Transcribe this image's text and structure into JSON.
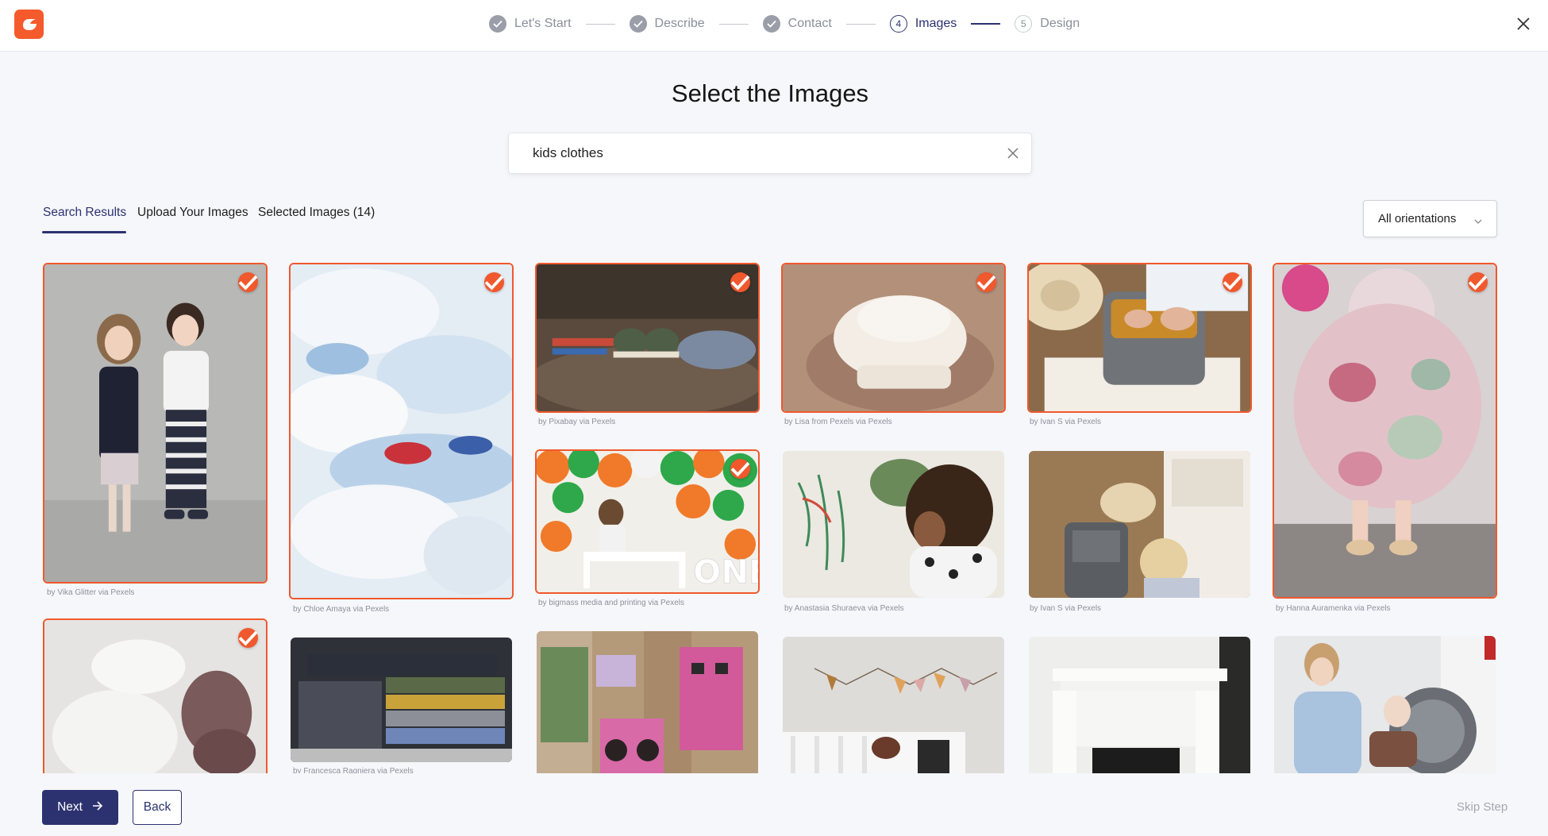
{
  "header": {
    "steps": [
      {
        "label": "Let's Start",
        "state": "done"
      },
      {
        "label": "Describe",
        "state": "done"
      },
      {
        "label": "Contact",
        "state": "done"
      },
      {
        "label": "Images",
        "number": "4",
        "state": "current"
      },
      {
        "label": "Design",
        "number": "5",
        "state": "upcoming"
      }
    ],
    "brand_color": "#f55a2c"
  },
  "title": "Select the Images",
  "search": {
    "value": "kids clothes",
    "placeholder": ""
  },
  "tabs": [
    {
      "label": "Search Results",
      "active": true
    },
    {
      "label": "Upload Your Images",
      "active": false
    },
    {
      "label": "Selected Images (14)",
      "active": false
    }
  ],
  "orientation_filter": {
    "selected": "All orientations"
  },
  "images": [
    {
      "credit": "by Vika Glitter via Pexels",
      "selected": true,
      "subject": "two-kids-posing"
    },
    {
      "credit": "by Chloe Amaya via Pexels",
      "selected": true,
      "subject": "pile-of-baby-clothes"
    },
    {
      "credit": "by Pixabay via Pexels",
      "selected": true,
      "subject": "baby-shoes"
    },
    {
      "credit": "by Lisa from Pexels via Pexels",
      "selected": true,
      "subject": "folded-white-onesies"
    },
    {
      "credit": "by Ivan S via Pexels",
      "selected": true,
      "subject": "packing-suitcase"
    },
    {
      "credit": "by Hanna Auramenka via Pexels",
      "selected": true,
      "subject": "girl-in-floral-dress"
    },
    {
      "credit": "by bigmass media and printing via Pexels",
      "selected": true,
      "subject": "toddler-with-balloons"
    },
    {
      "credit": "by Anastasia Shuraeva via Pexels",
      "selected": false,
      "subject": "child-painting-wall"
    },
    {
      "credit": "by Ivan S via Pexels",
      "selected": false,
      "subject": "woman-packing-suitcase"
    },
    {
      "credit": "",
      "selected": true,
      "subject": "knit-baby-clothes"
    },
    {
      "credit": "by Francesca Ragniera via Pexels",
      "selected": false,
      "subject": "folded-clothes-drawer"
    },
    {
      "credit": "",
      "selected": false,
      "subject": "kids-store-boxes"
    },
    {
      "credit": "",
      "selected": false,
      "subject": "nursery-crib-bunting"
    },
    {
      "credit": "",
      "selected": false,
      "subject": "white-fireplace"
    },
    {
      "credit": "",
      "selected": false,
      "subject": "mother-child-laundry"
    }
  ],
  "footer": {
    "next_label": "Next",
    "back_label": "Back",
    "skip_label": "Skip Step"
  },
  "colors": {
    "accent": "#2c3270",
    "selected_border": "#f0582d"
  }
}
